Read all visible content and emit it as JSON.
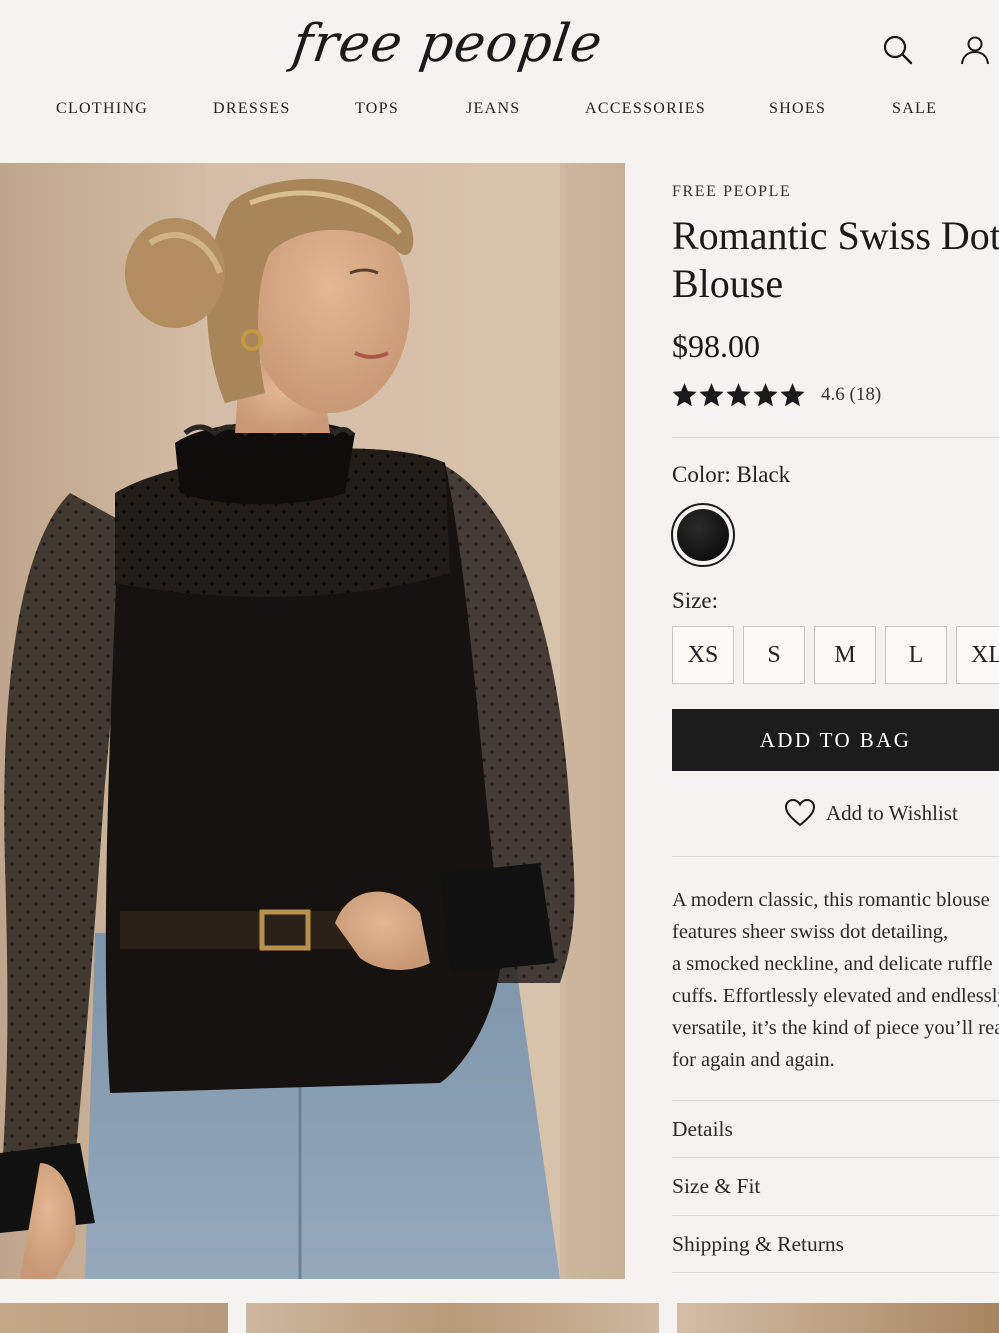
{
  "header": {
    "logo_text": "free people",
    "nav": [
      "CLOTHING",
      "DRESSES",
      "TOPS",
      "JEANS",
      "ACCESSORIES",
      "SHOES",
      "SALE"
    ]
  },
  "product": {
    "brand": "FREE PEOPLE",
    "title": "Romantic Swiss Dot Blouse",
    "price": "$98.00",
    "rating_value": 4.6,
    "rating_text": "4.6 (18)",
    "stars_filled": 5,
    "color_label": "Color:",
    "color_value": "Black",
    "color_swatch": "#0b0b0b",
    "size_label": "Size:",
    "sizes": [
      "XS",
      "S",
      "M",
      "L",
      "XL"
    ],
    "add_to_bag": "ADD TO BAG",
    "wishlist": "Add to Wishlist",
    "description_lines": [
      "A modern classic, this romantic blouse",
      "features sheer swiss dot detailing,",
      "a smocked neckline, and delicate ruffle",
      "cuffs. Effortlessly elevated and endlessly",
      "versatile, it’s the kind of piece you’ll reach",
      "for again and again."
    ],
    "accordions": [
      "Details",
      "Size & Fit",
      "Shipping & Returns"
    ]
  },
  "colors": {
    "background": "#f5f3ef",
    "button": "#1d1c1c",
    "text": "#1c1c1c"
  },
  "icons": [
    "search-icon",
    "account-icon",
    "star-icon",
    "heart-icon"
  ]
}
